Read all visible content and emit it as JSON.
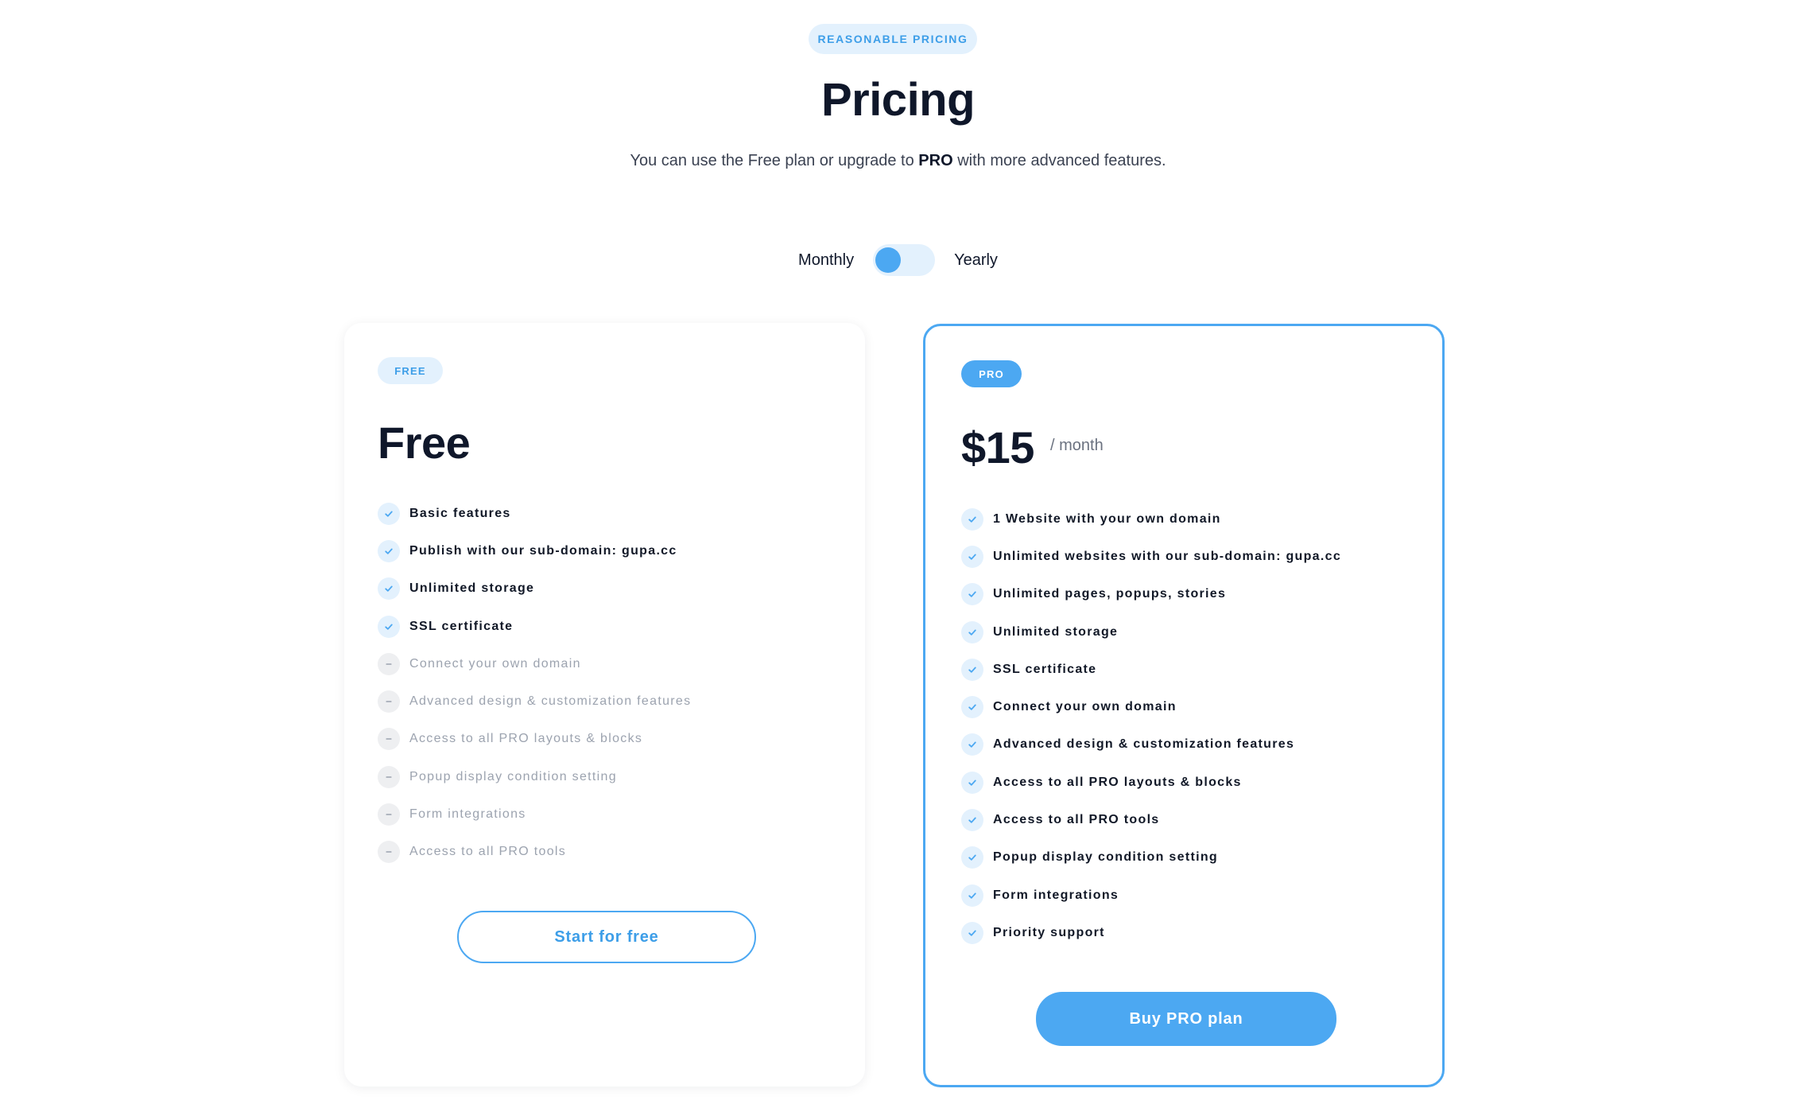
{
  "header": {
    "badge": "REASONABLE PRICING",
    "title": "Pricing",
    "subtitle_before": "You can use the Free plan or upgrade to ",
    "subtitle_bold": "PRO",
    "subtitle_after": " with more advanced features."
  },
  "billing_toggle": {
    "left_label": "Monthly",
    "right_label": "Yearly",
    "selected": "Monthly"
  },
  "plans": {
    "free": {
      "badge": "FREE",
      "name": "Free",
      "features": [
        {
          "label": "Basic features",
          "included": true
        },
        {
          "label": "Publish with our sub-domain: gupa.cc",
          "included": true
        },
        {
          "label": "Unlimited storage",
          "included": true
        },
        {
          "label": "SSL certificate",
          "included": true
        },
        {
          "label": "Connect your own domain",
          "included": false
        },
        {
          "label": "Advanced design & customization features",
          "included": false
        },
        {
          "label": "Access to all PRO layouts & blocks",
          "included": false
        },
        {
          "label": "Popup display condition setting",
          "included": false
        },
        {
          "label": "Form integrations",
          "included": false
        },
        {
          "label": "Access to all PRO tools",
          "included": false
        }
      ],
      "button_label": "Start for free"
    },
    "pro": {
      "badge": "PRO",
      "price": "$15",
      "period": "/ month",
      "features": [
        {
          "label": "1 Website with your own domain",
          "included": true
        },
        {
          "label": "Unlimited websites with our sub-domain: gupa.cc",
          "included": true
        },
        {
          "label": "Unlimited pages, popups, stories",
          "included": true
        },
        {
          "label": "Unlimited storage",
          "included": true
        },
        {
          "label": "SSL certificate",
          "included": true
        },
        {
          "label": "Connect your own domain",
          "included": true
        },
        {
          "label": "Advanced design & customization features",
          "included": true
        },
        {
          "label": "Access to all PRO layouts & blocks",
          "included": true
        },
        {
          "label": "Access to all PRO tools",
          "included": true
        },
        {
          "label": "Popup display condition setting",
          "included": true
        },
        {
          "label": "Form integrations",
          "included": true
        },
        {
          "label": "Priority support",
          "included": true
        }
      ],
      "button_label": "Buy PRO plan"
    }
  },
  "colors": {
    "accent": "#4ca8f2",
    "accent_light": "#e3f1fd",
    "text_dark": "#0f172a",
    "text_muted": "#9ca3af"
  },
  "icons": {
    "included": "check-icon",
    "excluded": "dash-icon"
  }
}
